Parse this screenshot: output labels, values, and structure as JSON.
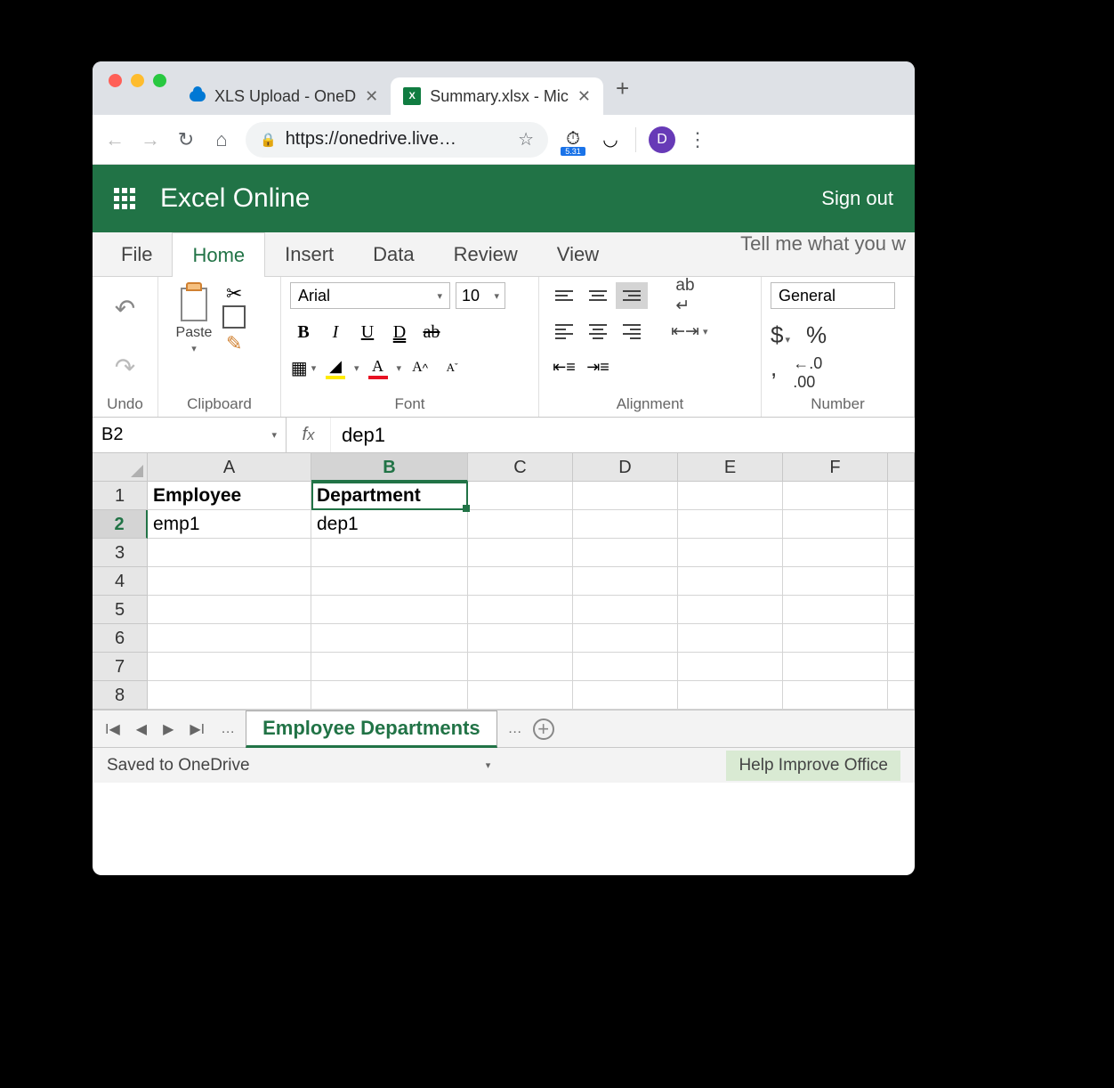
{
  "browser": {
    "tabs": [
      {
        "title": "XLS Upload - OneD",
        "active": false
      },
      {
        "title": "Summary.xlsx - Mic",
        "active": true
      }
    ],
    "url": "https://onedrive.live…",
    "gauge_badge": "5.31",
    "avatar_initial": "D"
  },
  "app": {
    "title": "Excel Online",
    "signout": "Sign out"
  },
  "ribbon": {
    "tabs": [
      "File",
      "Home",
      "Insert",
      "Data",
      "Review",
      "View"
    ],
    "active": "Home",
    "tellme": "Tell me what you w",
    "groups": {
      "undo": "Undo",
      "clipboard": "Clipboard",
      "paste": "Paste",
      "font": "Font",
      "alignment": "Alignment",
      "number": "Number"
    },
    "font_name": "Arial",
    "font_size": "10",
    "number_format": "General"
  },
  "formula": {
    "namebox": "B2",
    "value": "dep1"
  },
  "grid": {
    "columns": [
      "A",
      "B",
      "C",
      "D",
      "E",
      "F"
    ],
    "selected_col": "B",
    "selected_row": 2,
    "rows": 8,
    "cells": {
      "A1": "Employee",
      "B1": "Department",
      "A2": "emp1",
      "B2": "dep1"
    }
  },
  "sheet": {
    "active": "Employee Departments"
  },
  "status": {
    "left": "Saved to OneDrive",
    "help": "Help Improve Office"
  }
}
